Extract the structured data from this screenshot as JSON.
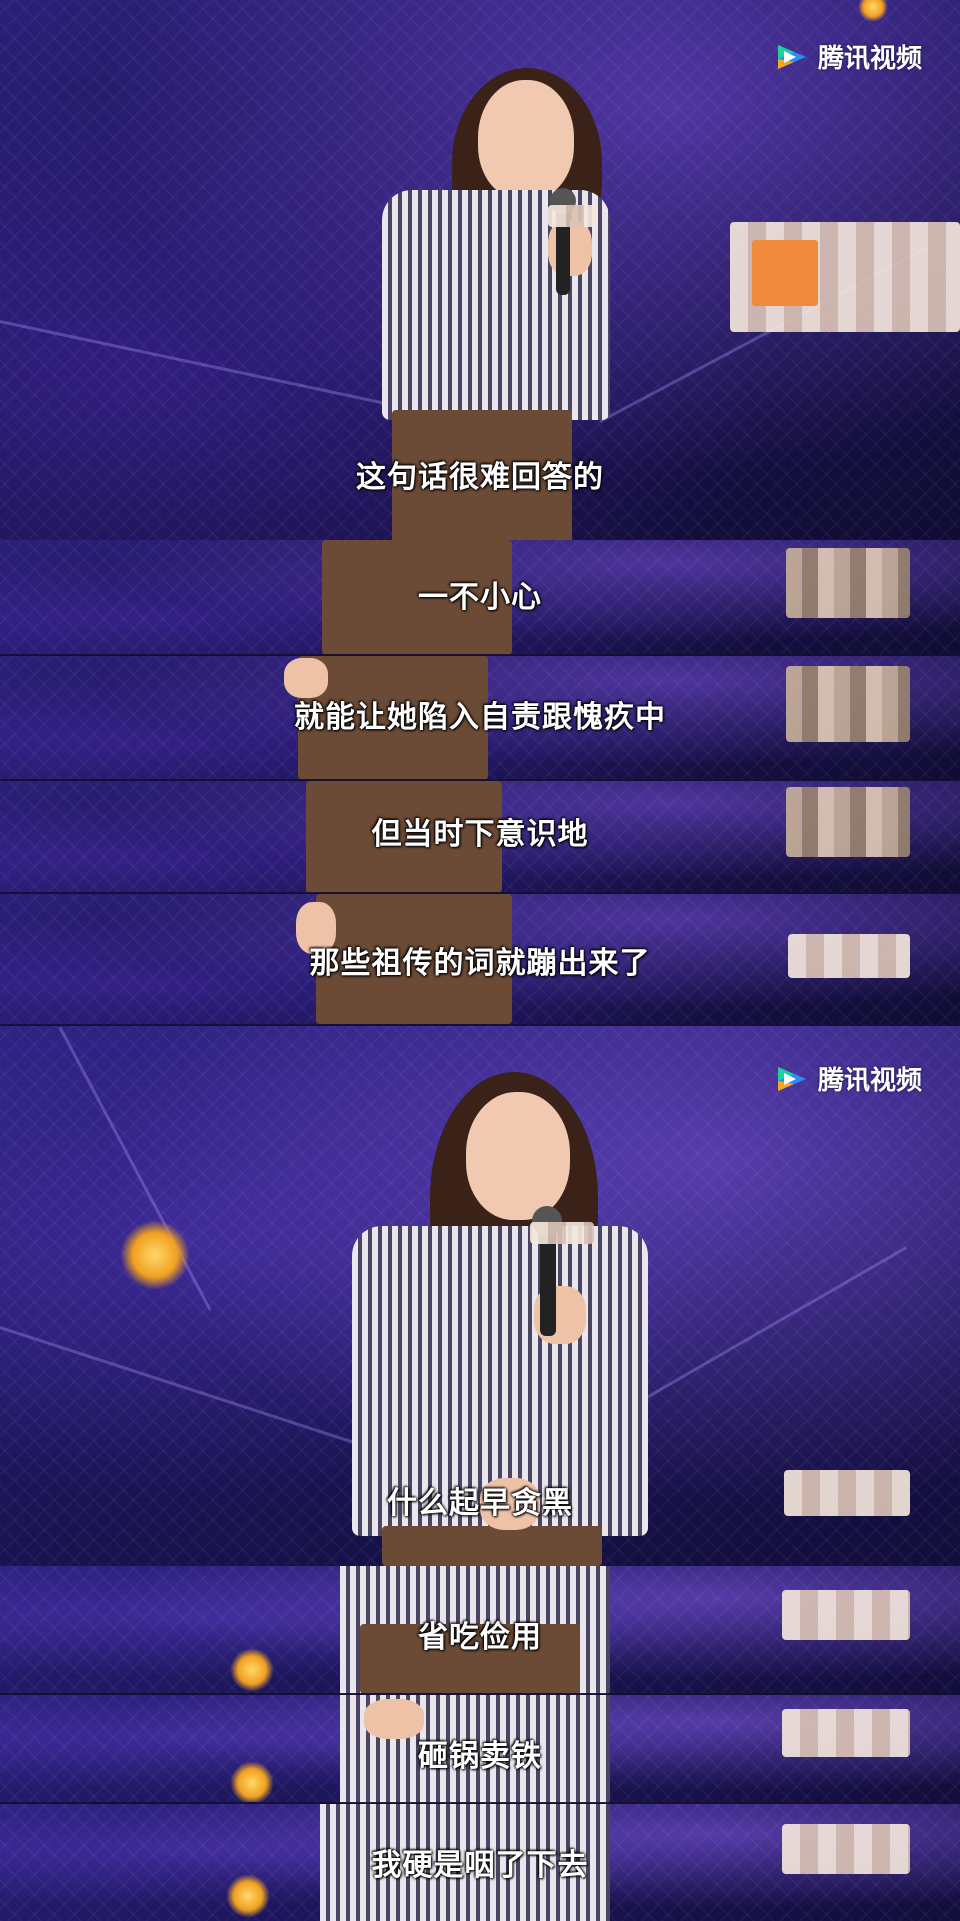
{
  "brand": {
    "logo_text": "腾讯视频",
    "logo_colors": [
      "#1fd0a0",
      "#2c8df4",
      "#f5a623"
    ]
  },
  "panel_top": {
    "subtitles": [
      "这句话很难回答的",
      "一不小心",
      "就能让她陷入自责跟愧疚中",
      "但当时下意识地",
      "那些祖传的词就蹦出来了"
    ]
  },
  "panel_bottom": {
    "subtitles": [
      "什么起早贪黑",
      "省吃俭用",
      "砸锅卖铁",
      "我硬是咽了下去"
    ]
  },
  "colors": {
    "stage_purple": "#1d165c",
    "subtitle_text": "#ffffff",
    "shirt_stripes": "#4a4560",
    "pants": "#6b4a36"
  }
}
